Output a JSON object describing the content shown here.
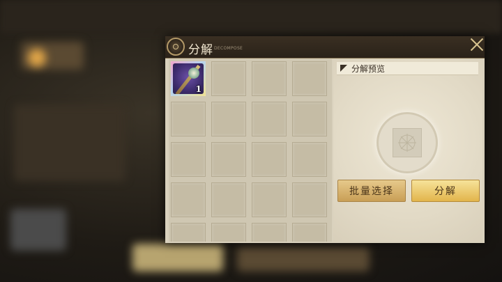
{
  "dialog": {
    "title": "分解",
    "subtitle": "DECOMPOSE",
    "close_icon": "close-icon"
  },
  "inventory": {
    "slots": [
      {
        "item": "weapon-staff",
        "rarity_color": "#6b4fa6",
        "count": "1"
      },
      {},
      {},
      {},
      {},
      {},
      {},
      {},
      {},
      {},
      {},
      {},
      {},
      {},
      {},
      {},
      {},
      {},
      {},
      {}
    ]
  },
  "preview": {
    "title": "分解预览"
  },
  "buttons": {
    "batch_select": "批量选择",
    "decompose": "分解"
  },
  "colors": {
    "accent_gold": "#e2b54c",
    "header_bg": "#2a2219",
    "panel_bg": "#d9d1bd"
  }
}
